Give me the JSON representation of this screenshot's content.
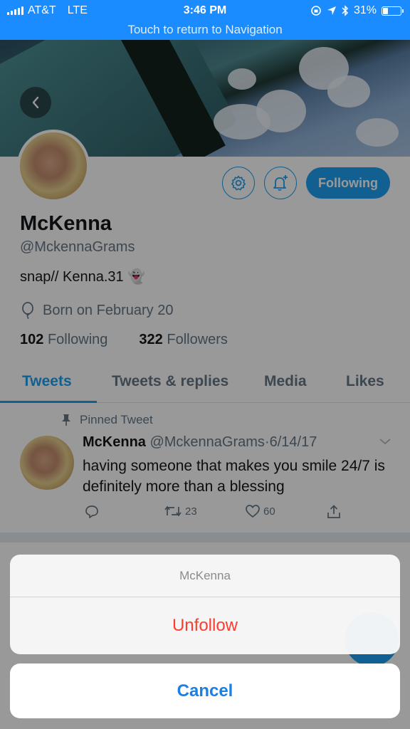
{
  "status_bar": {
    "carrier": "AT&T",
    "network": "LTE",
    "time": "3:46 PM",
    "battery": "31%",
    "battery_level": 0.31,
    "return_text": "Touch to return to Navigation"
  },
  "profile": {
    "name": "McKenna",
    "handle": "@MckennaGrams",
    "bio": "snap// Kenna.31 👻",
    "born": "Born on February 20",
    "following_count": "102",
    "following_label": "Following",
    "followers_count": "322",
    "followers_label": "Followers",
    "follow_button": "Following"
  },
  "tabs": [
    "Tweets",
    "Tweets & replies",
    "Media",
    "Likes"
  ],
  "tweet": {
    "pinned_label": "Pinned Tweet",
    "author": "McKenna",
    "handle": "@MckennaGrams",
    "separator": "·",
    "date": "6/14/17",
    "text": "having someone that makes you smile 24/7 is definitely more than a blessing",
    "retweets": "23",
    "likes": "60"
  },
  "action_sheet": {
    "title": "McKenna",
    "unfollow": "Unfollow",
    "cancel": "Cancel"
  },
  "colors": {
    "accent": "#1da1f2",
    "status_bar": "#1a8cff",
    "destructive": "#ff3b30"
  },
  "icons": [
    "back-chevron-icon",
    "settings-gear-icon",
    "notification-bell-icon",
    "birthday-balloon-icon",
    "pin-icon",
    "reply-icon",
    "retweet-icon",
    "like-heart-icon",
    "share-icon",
    "chevron-down-icon"
  ]
}
